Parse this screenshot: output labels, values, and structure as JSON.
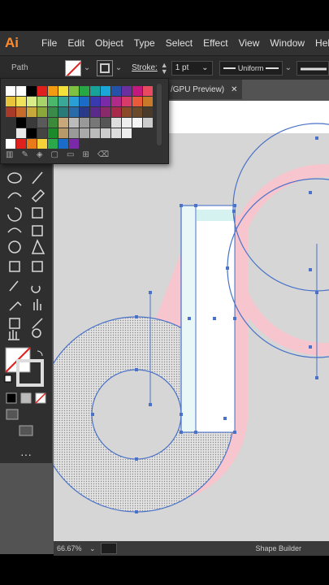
{
  "app": {
    "logo": "Ai"
  },
  "menu": {
    "items": [
      "File",
      "Edit",
      "Object",
      "Type",
      "Select",
      "Effect",
      "View",
      "Window",
      "Help"
    ]
  },
  "control": {
    "selection_label": "Path",
    "stroke_label": "Stroke:",
    "stroke_weight": "1 pt",
    "profile_label": "Uniform"
  },
  "document": {
    "tab_title": "/GPU Preview)"
  },
  "status": {
    "zoom": "66.67%",
    "page": "1",
    "current_tool": "Shape Builder"
  },
  "colors": {
    "selection_blue": "#4a72c8",
    "canvas_gray": "#d6d6d6",
    "tiktok_pink": "#f6c5cd",
    "tiktok_cyan": "#d6f2f0",
    "ai_orange": "#ff8a2a"
  },
  "icons": [
    "home-icon",
    "selection-tool-icon",
    "pen-tool-icon",
    "type-tool-icon",
    "ellipse-tool-icon",
    "shape-builder-icon",
    "hand-tool-icon",
    "zoom-tool-icon"
  ]
}
